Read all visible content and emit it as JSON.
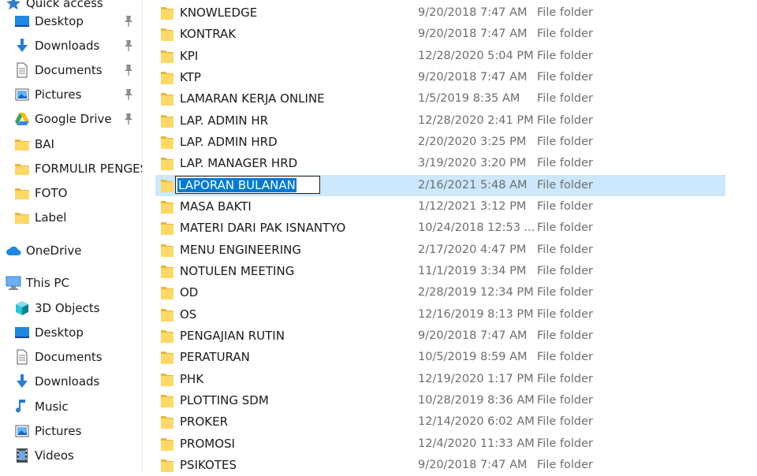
{
  "nav": {
    "items": [
      {
        "label": "Quick access",
        "icon": "star-icon",
        "pinned": false,
        "indent": false
      },
      {
        "label": "Desktop",
        "icon": "desktop-icon",
        "pinned": true,
        "indent": true
      },
      {
        "label": "Downloads",
        "icon": "download-icon",
        "pinned": true,
        "indent": true
      },
      {
        "label": "Documents",
        "icon": "document-icon",
        "pinned": true,
        "indent": true
      },
      {
        "label": "Pictures",
        "icon": "pictures-icon",
        "pinned": true,
        "indent": true
      },
      {
        "label": "Google Drive",
        "icon": "google-drive-icon",
        "pinned": true,
        "indent": true
      },
      {
        "label": "BAI",
        "icon": "folder-icon",
        "pinned": false,
        "indent": true
      },
      {
        "label": "FORMULIR PENGESAHAN",
        "icon": "folder-icon",
        "pinned": false,
        "indent": true
      },
      {
        "label": "FOTO",
        "icon": "folder-icon",
        "pinned": false,
        "indent": true
      },
      {
        "label": "Label",
        "icon": "folder-icon",
        "pinned": false,
        "indent": true
      },
      {
        "label": "OneDrive",
        "icon": "cloud-icon",
        "pinned": false,
        "indent": false
      },
      {
        "label": "This PC",
        "icon": "computer-icon",
        "pinned": false,
        "indent": false
      },
      {
        "label": "3D Objects",
        "icon": "cube-icon",
        "pinned": false,
        "indent": true
      },
      {
        "label": "Desktop",
        "icon": "desktop-icon",
        "pinned": false,
        "indent": true
      },
      {
        "label": "Documents",
        "icon": "document-icon",
        "pinned": false,
        "indent": true
      },
      {
        "label": "Downloads",
        "icon": "download-icon",
        "pinned": false,
        "indent": true
      },
      {
        "label": "Music",
        "icon": "music-icon",
        "pinned": false,
        "indent": true
      },
      {
        "label": "Pictures",
        "icon": "pictures-icon",
        "pinned": false,
        "indent": true
      },
      {
        "label": "Videos",
        "icon": "video-icon",
        "pinned": false,
        "indent": true
      }
    ]
  },
  "files": [
    {
      "name": "KNOWLEDGE",
      "date": "9/20/2018 7:47 AM",
      "type": "File folder"
    },
    {
      "name": "KONTRAK",
      "date": "9/20/2018 7:47 AM",
      "type": "File folder"
    },
    {
      "name": "KPI",
      "date": "12/28/2020 5:04 PM",
      "type": "File folder"
    },
    {
      "name": "KTP",
      "date": "9/20/2018 7:47 AM",
      "type": "File folder"
    },
    {
      "name": "LAMARAN KERJA ONLINE",
      "date": "1/5/2019 8:35 AM",
      "type": "File folder"
    },
    {
      "name": "LAP. ADMIN HR",
      "date": "12/28/2020 2:41 PM",
      "type": "File folder"
    },
    {
      "name": "LAP. ADMIN HRD",
      "date": "2/20/2020 3:25 PM",
      "type": "File folder"
    },
    {
      "name": "LAP. MANAGER HRD",
      "date": "3/19/2020 3:20 PM",
      "type": "File folder"
    },
    {
      "name": "LAPORAN BULANAN",
      "date": "2/16/2021 5:48 AM",
      "type": "File folder",
      "selected": true,
      "renaming": true
    },
    {
      "name": "MASA BAKTI",
      "date": "1/12/2021 3:12 PM",
      "type": "File folder"
    },
    {
      "name": "MATERI DARI PAK ISNANTYO",
      "date": "10/24/2018 12:53 ...",
      "type": "File folder"
    },
    {
      "name": "MENU ENGINEERING",
      "date": "2/17/2020 4:47 PM",
      "type": "File folder"
    },
    {
      "name": "NOTULEN MEETING",
      "date": "11/1/2019 3:34 PM",
      "type": "File folder"
    },
    {
      "name": "OD",
      "date": "2/28/2019 12:34 PM",
      "type": "File folder"
    },
    {
      "name": "OS",
      "date": "12/16/2019 8:13 PM",
      "type": "File folder"
    },
    {
      "name": "PENGAJIAN RUTIN",
      "date": "9/20/2018 7:47 AM",
      "type": "File folder"
    },
    {
      "name": "PERATURAN",
      "date": "10/5/2019 8:59 AM",
      "type": "File folder"
    },
    {
      "name": "PHK",
      "date": "12/19/2020 1:17 PM",
      "type": "File folder"
    },
    {
      "name": "PLOTTING SDM",
      "date": "10/28/2019 8:36 AM",
      "type": "File folder"
    },
    {
      "name": "PROKER",
      "date": "12/14/2020 6:02 AM",
      "type": "File folder"
    },
    {
      "name": "PROMOSI",
      "date": "12/4/2020 11:33 AM",
      "type": "File folder"
    },
    {
      "name": "PSIKOTES",
      "date": "9/20/2018 7:47 AM",
      "type": "File folder"
    }
  ],
  "colors": {
    "selection_bg": "#cce8ff",
    "rename_highlight": "#0078d7",
    "folder_yellow": "#ffd866",
    "secondary_text": "#6d6d6d"
  }
}
